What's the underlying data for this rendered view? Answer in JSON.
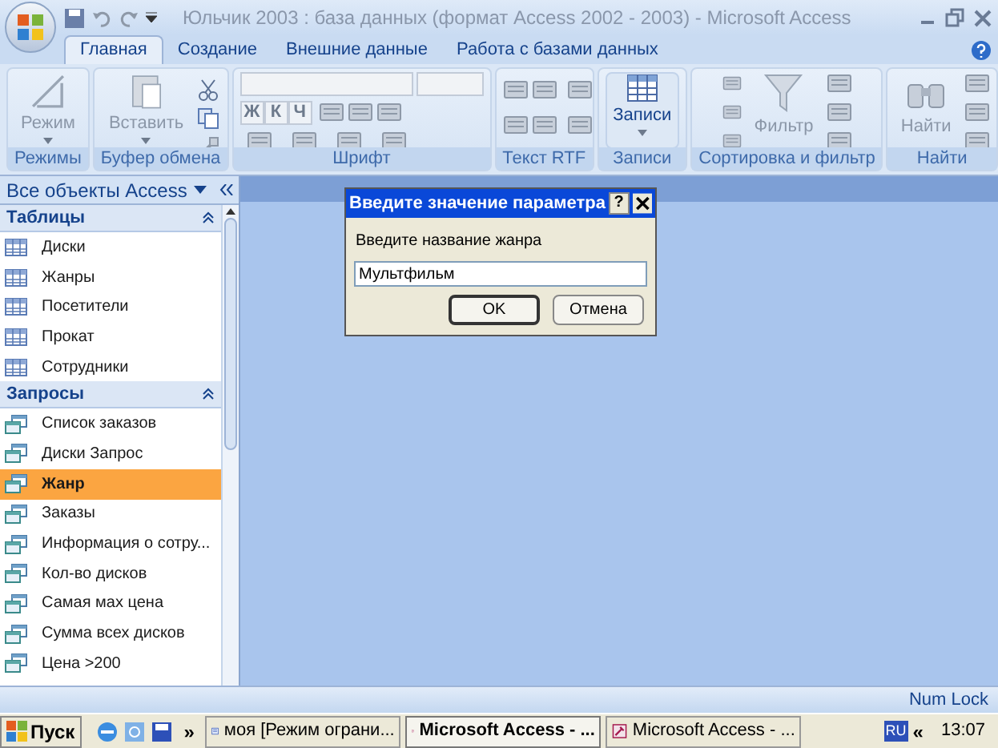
{
  "window": {
    "title": "Юльчик 2003 : база данных (формат Access 2002 - 2003) - Microsoft Access"
  },
  "tabs": [
    {
      "label": "Главная",
      "selected": true
    },
    {
      "label": "Создание",
      "selected": false
    },
    {
      "label": "Внешние данные",
      "selected": false
    },
    {
      "label": "Работа с базами данных",
      "selected": false
    }
  ],
  "ribbon": {
    "groups": [
      {
        "kind": "mode",
        "label": "Режимы",
        "buttons": [
          "Режим"
        ]
      },
      {
        "kind": "clipboard",
        "label": "Буфер обмена",
        "buttons": [
          "Вставить"
        ]
      },
      {
        "kind": "font",
        "label": "Шрифт",
        "buttons": [
          "Ж",
          "К",
          "Ч"
        ]
      },
      {
        "kind": "rtf",
        "label": "Текст RTF"
      },
      {
        "kind": "records",
        "label": "Записи",
        "buttons": [
          "Записи"
        ]
      },
      {
        "kind": "sort",
        "label": "Сортировка и фильтр",
        "buttons": [
          "Фильтр"
        ]
      },
      {
        "kind": "find",
        "label": "Найти",
        "buttons": [
          "Найти"
        ]
      }
    ]
  },
  "nav": {
    "title": "Все объекты Access",
    "sections": [
      {
        "kind": "table",
        "title": "Таблицы",
        "items": [
          {
            "label": "Диски",
            "selected": false
          },
          {
            "label": "Жанры",
            "selected": false
          },
          {
            "label": "Посетители",
            "selected": false
          },
          {
            "label": "Прокат",
            "selected": false
          },
          {
            "label": "Сотрудники",
            "selected": false
          }
        ]
      },
      {
        "kind": "query",
        "title": "Запросы",
        "items": [
          {
            "label": "Список заказов",
            "selected": false
          },
          {
            "label": "Диски Запрос",
            "selected": false
          },
          {
            "label": "Жанр",
            "selected": true
          },
          {
            "label": "Заказы",
            "selected": false
          },
          {
            "label": "Информация о сотру...",
            "selected": false
          },
          {
            "label": "Кол-во дисков",
            "selected": false
          },
          {
            "label": "Самая мах цена",
            "selected": false
          },
          {
            "label": "Сумма всех дисков",
            "selected": false
          },
          {
            "label": "Цена >200",
            "selected": false
          }
        ]
      }
    ]
  },
  "dialog": {
    "title": "Введите значение параметра",
    "help": "?",
    "prompt": "Введите название жанра",
    "value": "Мультфильм",
    "buttons": [
      "OK",
      "Отмена"
    ]
  },
  "status_bar": {
    "text": "Num Lock"
  },
  "taskbar": {
    "start": "Пуск",
    "more": "»",
    "items": [
      {
        "kind": "word",
        "label": "моя [Режим ограни...",
        "selected": false
      },
      {
        "kind": "access",
        "label": "Microsoft Access - ...",
        "selected": true
      },
      {
        "kind": "access",
        "label": "Microsoft Access - ...",
        "selected": false
      }
    ],
    "language": "RU",
    "tray_toggle": "«",
    "clock": "13:07"
  }
}
